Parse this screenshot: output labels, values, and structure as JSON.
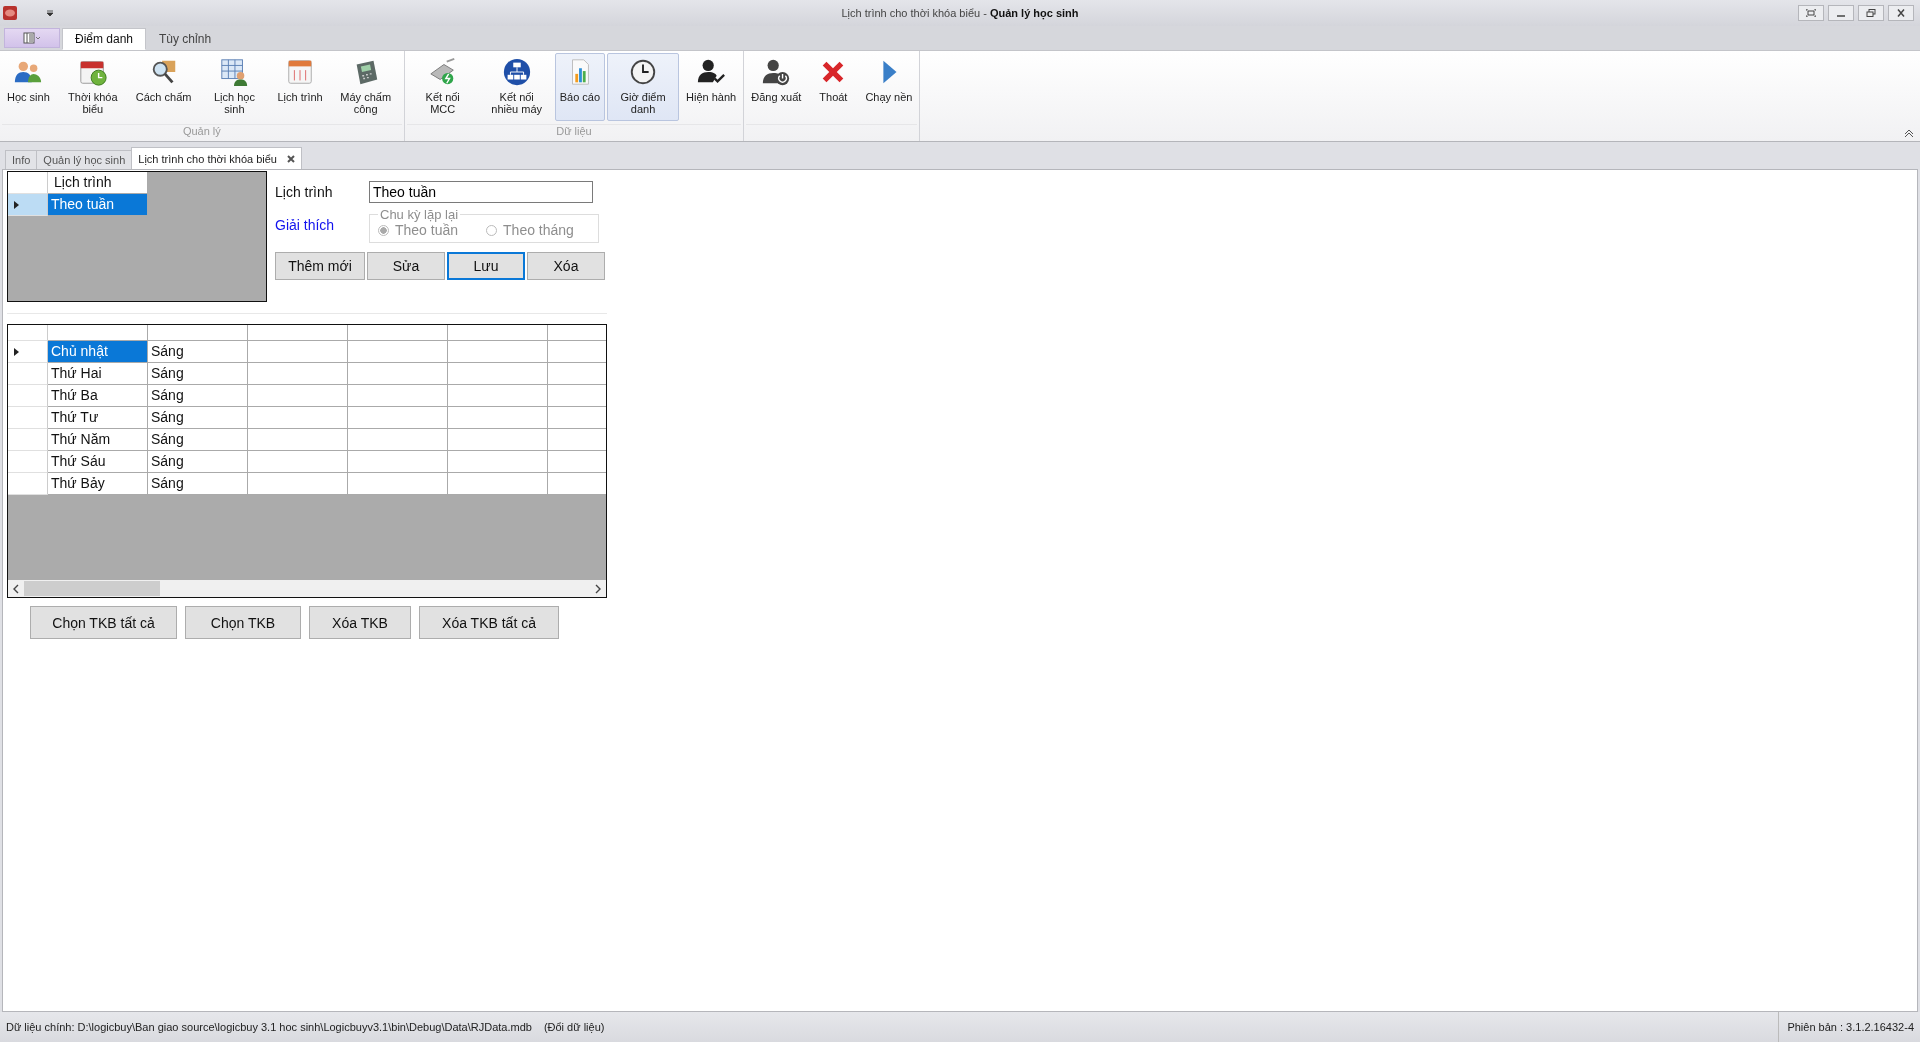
{
  "window": {
    "title": "Lịch trình cho thời khóa biểu - **Quản lý học sinh**"
  },
  "ribbon": {
    "tabs": [
      {
        "label": "Điểm danh",
        "selected": true
      },
      {
        "label": "Tùy chỉnh",
        "selected": false
      }
    ],
    "groups": [
      {
        "name": "Quản lý",
        "buttons": [
          {
            "label": "Học sinh",
            "selected": false
          },
          {
            "label": "Thời khóa biểu",
            "selected": false
          },
          {
            "label": "Cách chấm",
            "selected": false
          },
          {
            "label": "Lịch học sinh",
            "selected": false
          },
          {
            "label": "Lịch trình",
            "selected": false
          },
          {
            "label": "Máy chấm công",
            "selected": false
          }
        ]
      },
      {
        "name": "Dữ liệu",
        "buttons": [
          {
            "label": "Kết nối MCC",
            "selected": false
          },
          {
            "label": "Kết nối nhiều máy",
            "selected": false
          },
          {
            "label": "Báo cáo",
            "selected": true
          },
          {
            "label": "Giờ điểm danh",
            "selected": true
          },
          {
            "label": "Hiện hành",
            "selected": false
          }
        ]
      },
      {
        "buttons": [
          {
            "label": "Đăng xuất",
            "selected": false
          },
          {
            "label": "Thoát",
            "selected": false
          },
          {
            "label": "Chạy nền",
            "selected": false
          }
        ]
      }
    ]
  },
  "doc_tabs": [
    {
      "label": "Info",
      "selected": false,
      "closable": false
    },
    {
      "label": "Quản lý học sinh",
      "selected": false,
      "closable": false
    },
    {
      "label": "Lịch trình cho thời khóa biểu",
      "selected": true,
      "closable": true
    }
  ],
  "schedule_list": {
    "column": "Lịch trình",
    "rows": [
      {
        "name": "Theo tuần",
        "selected": true
      }
    ]
  },
  "form": {
    "schedule_label": "Lịch trình",
    "schedule_value": "Theo tuần",
    "note_link": "Giải thích",
    "cycle": {
      "title": "Chu kỳ lặp lại",
      "disabled": true,
      "options": [
        {
          "label": "Theo tuần",
          "selected": true
        },
        {
          "label": "Theo tháng",
          "selected": false
        }
      ]
    },
    "buttons": [
      {
        "label": "Thêm mới",
        "focused": false
      },
      {
        "label": "Sửa",
        "focused": false
      },
      {
        "label": "Lưu",
        "focused": true
      },
      {
        "label": "Xóa",
        "focused": false
      }
    ]
  },
  "timetable": {
    "rows": [
      {
        "day": "Chủ nhật",
        "session": "Sáng",
        "selected": true
      },
      {
        "day": "Thứ Hai",
        "session": "Sáng",
        "selected": false
      },
      {
        "day": "Thứ Ba",
        "session": "Sáng",
        "selected": false
      },
      {
        "day": "Thứ Tư",
        "session": "Sáng",
        "selected": false
      },
      {
        "day": "Thứ Năm",
        "session": "Sáng",
        "selected": false
      },
      {
        "day": "Thứ Sáu",
        "session": "Sáng",
        "selected": false
      },
      {
        "day": "Thứ Bảy",
        "session": "Sáng",
        "selected": false
      }
    ]
  },
  "actions": [
    "Chọn TKB tất cả",
    "Chọn TKB",
    "Xóa TKB",
    "Xóa TKB tất cả"
  ],
  "status_bar": {
    "data_path": "Dữ liệu chính: D:\\logicbuy\\Ban giao source\\logicbuy 3.1 hoc sinh\\Logicbuyv3.1\\bin\\Debug\\Data\\RJData.mdb",
    "change_link": "(Đổi dữ liệu)",
    "version": "Phiên bản : 3.1.2.16432-4"
  }
}
